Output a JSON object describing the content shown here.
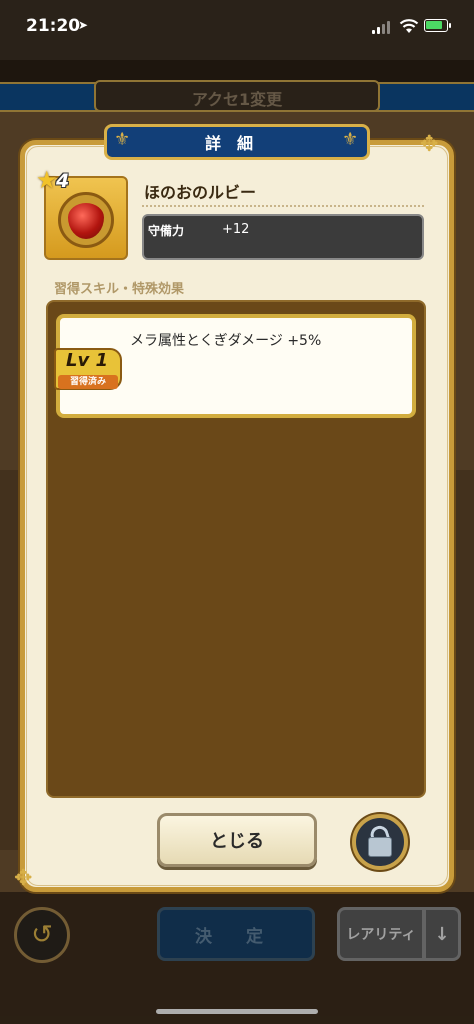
{
  "status_bar": {
    "time": "21:20",
    "location_arrow": "➤"
  },
  "background_screen": {
    "title": "アクセ1変更",
    "decide_label": "決 定",
    "rarity_label": "レアリティ",
    "sort_arrow": "↓",
    "back_icon": "↺"
  },
  "dialog": {
    "title": "詳細",
    "item": {
      "rarity_stars": "4",
      "name": "ほのおのルビー",
      "stat_label": "守備力",
      "stat_value": "+12"
    },
    "section_label": "習得スキル・特殊効果",
    "skills": [
      {
        "level": "Lv 1",
        "status": "習得済み",
        "description": "メラ属性とくぎダメージ +5%"
      }
    ],
    "close_label": "とじる",
    "lock_state": "unlocked"
  },
  "colors": {
    "banner_blue": "#123f78",
    "gold_border": "#c89b3a",
    "panel_brown": "#6a4818",
    "dialog_bg": "#f5eed8"
  }
}
